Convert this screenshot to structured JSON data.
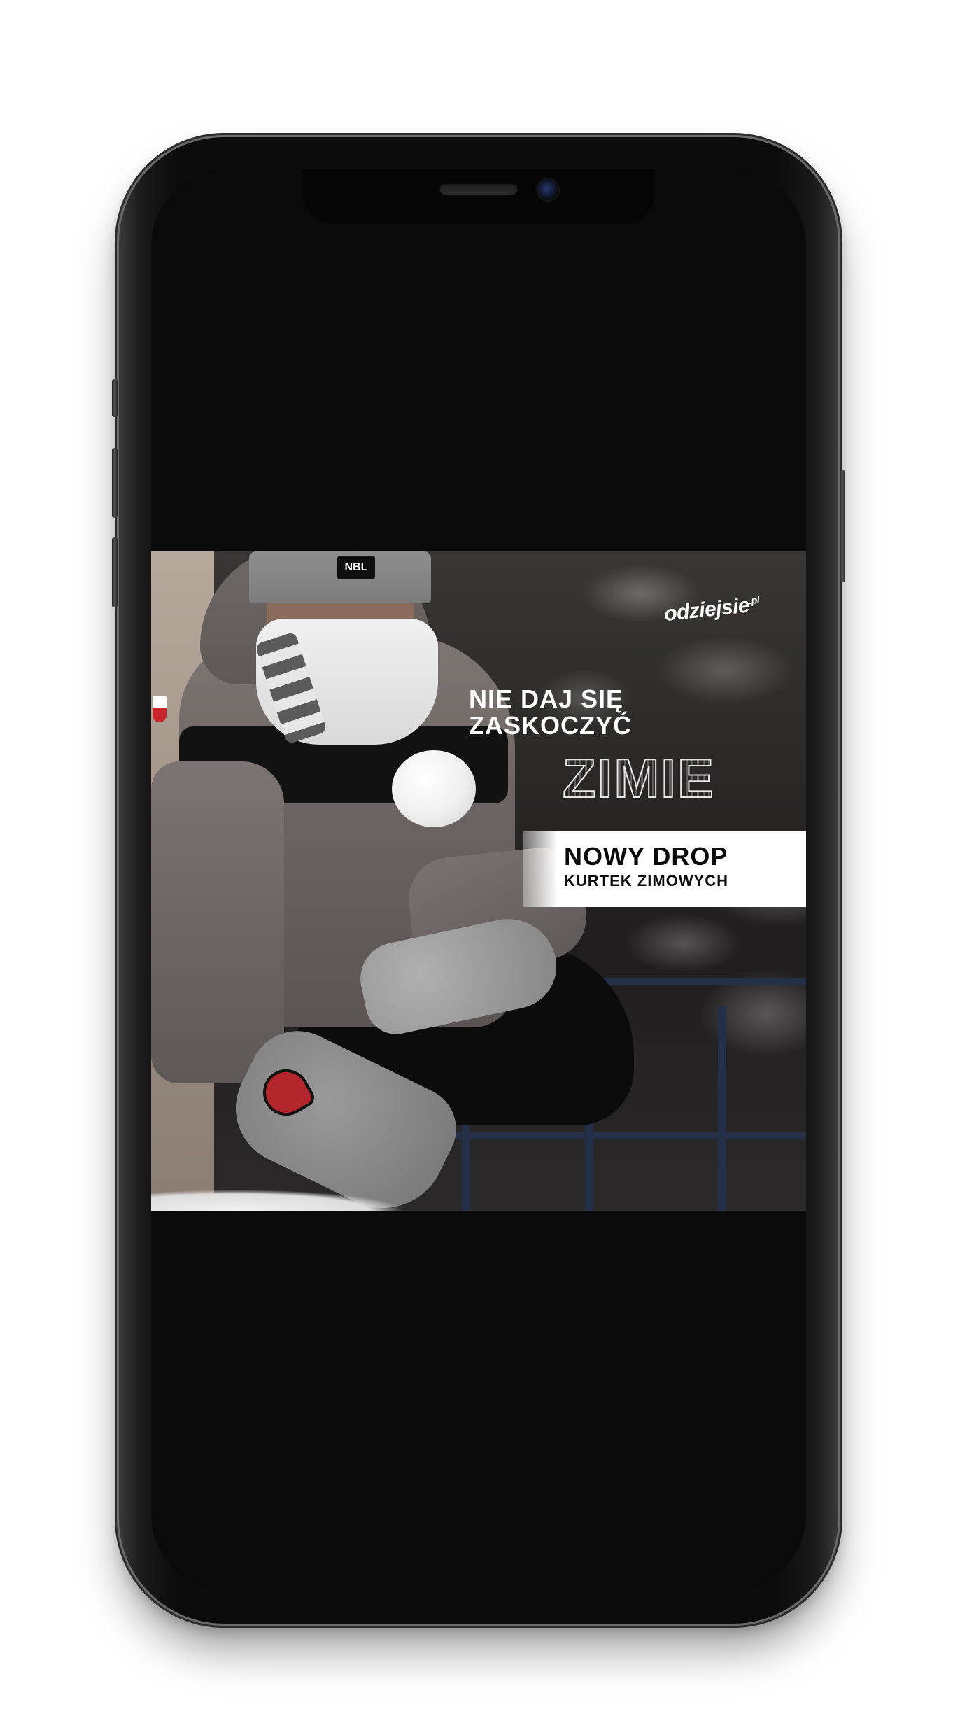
{
  "ad": {
    "logo": "odziejsie",
    "logo_suffix": ".pl",
    "beanie_tag": "NBL",
    "headline_line1": "NIE DAJ SIĘ",
    "headline_line2": "ZASKOCZYĆ",
    "headline_big": "ZIMIE",
    "drop_title": "NOWY DROP",
    "drop_subtitle": "KURTEK ZIMOWYCH"
  },
  "colors": {
    "screen_background": "#0a0a0a",
    "drop_box_background": "#ffffff",
    "text_light": "#ffffff",
    "text_dark": "#0b0b0b",
    "patch_red": "#b3262c"
  },
  "icons": [
    "front-camera-icon",
    "earpiece-speaker-icon"
  ]
}
